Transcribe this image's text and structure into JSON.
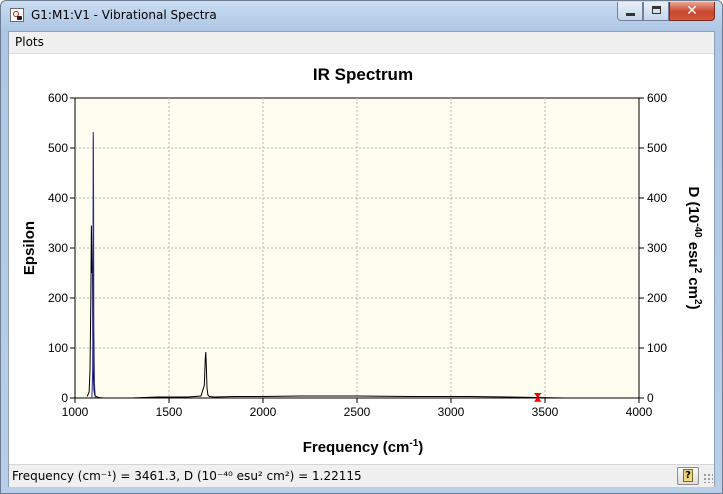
{
  "window": {
    "title": "G1:M1:V1 - Vibrational Spectra",
    "close_symbol": "✕"
  },
  "menu": {
    "plots_label": "Plots"
  },
  "chart_data": {
    "type": "line",
    "title": "IR Spectrum",
    "xlabel": "Frequency (cm",
    "xlabel_sup": "-1",
    "xlabel_close": ")",
    "ylabel": "Epsilon",
    "y2label_parts": [
      "D (10",
      "-40",
      " esu",
      "2",
      " cm",
      "2",
      ")"
    ],
    "xlim": [
      1000,
      4000
    ],
    "ylim": [
      0,
      600
    ],
    "y2lim": [
      0,
      600
    ],
    "xticks": [
      "1000",
      "1500",
      "2000",
      "2500",
      "3000",
      "3500",
      "4000"
    ],
    "yticks": [
      "0",
      "100",
      "200",
      "300",
      "400",
      "500",
      "600"
    ],
    "y2ticks": [
      "0",
      "100",
      "200",
      "300",
      "400",
      "500",
      "600"
    ],
    "grid": true,
    "series": [
      {
        "color": "#000000",
        "x": [
          1065,
          1075,
          1080,
          1084,
          1087,
          1089,
          1091,
          1093,
          1095,
          1098,
          1101,
          1105,
          1112,
          1125,
          1150,
          1200,
          1300,
          1440,
          1600,
          1670,
          1688,
          1693,
          1696,
          1699,
          1702,
          1707,
          1715,
          1740,
          1850,
          2000,
          2200,
          2500,
          2800,
          3100,
          3300,
          3461,
          3600
        ],
        "y": [
          3,
          12,
          55,
          190,
          345,
          300,
          250,
          255,
          130,
          45,
          15,
          6,
          3,
          1,
          0,
          0,
          0,
          2,
          2,
          4,
          25,
          80,
          92,
          60,
          20,
          6,
          3,
          2,
          3,
          3,
          4,
          4,
          3,
          3,
          2,
          1,
          0
        ]
      },
      {
        "color": "#2a2a8a",
        "x": [
          1090,
          1094,
          1096,
          1097,
          1098,
          1099,
          1100,
          1103,
          1108
        ],
        "y": [
          0,
          60,
          300,
          532,
          520,
          380,
          150,
          30,
          0
        ]
      }
    ],
    "marker": {
      "x": 3461.3,
      "y": 1.22115,
      "color": "#ff0000"
    }
  },
  "status": {
    "text": "Frequency (cm⁻¹) = 3461.3, D (10⁻⁴⁰ esu² cm²) = 1.22115"
  }
}
